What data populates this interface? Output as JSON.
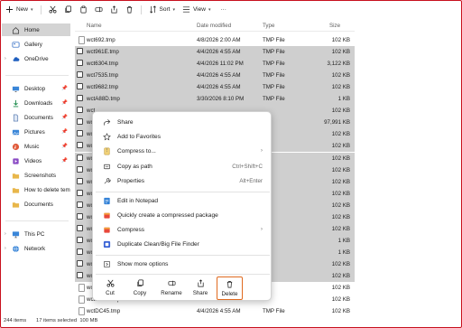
{
  "toolbar": {
    "new_label": "New",
    "sort_label": "Sort",
    "view_label": "View",
    "more_label": "···"
  },
  "sidebar": {
    "items": [
      {
        "label": "Home",
        "icon": "home-icon"
      },
      {
        "label": "Gallery",
        "icon": "gallery-icon"
      },
      {
        "label": "OneDrive",
        "icon": "cloud-icon"
      },
      {
        "label": "Desktop",
        "icon": "desktop-icon"
      },
      {
        "label": "Downloads",
        "icon": "download-icon"
      },
      {
        "label": "Documents",
        "icon": "document-icon"
      },
      {
        "label": "Pictures",
        "icon": "pictures-icon"
      },
      {
        "label": "Music",
        "icon": "music-icon"
      },
      {
        "label": "Videos",
        "icon": "video-icon"
      },
      {
        "label": "Screenshots",
        "icon": "folder-icon"
      },
      {
        "label": "How to delete tem",
        "icon": "folder-icon"
      },
      {
        "label": "Documents",
        "icon": "folder-icon"
      },
      {
        "label": "This PC",
        "icon": "pc-icon"
      },
      {
        "label": "Network",
        "icon": "network-icon"
      }
    ]
  },
  "filelist": {
    "headers": {
      "name": "Name",
      "date": "Date modified",
      "type": "Type",
      "size": "Size"
    },
    "rows": [
      {
        "name": "wct692.tmp",
        "date": "4/8/2026 2:00 AM",
        "type": "TMP File",
        "size": "102 KB",
        "selected": false
      },
      {
        "name": "wct961E.tmp",
        "date": "4/4/2026 4:55 AM",
        "type": "TMP File",
        "size": "102 KB",
        "selected": true
      },
      {
        "name": "wct6304.tmp",
        "date": "4/4/2026 11:02 PM",
        "type": "TMP File",
        "size": "3,122 KB",
        "selected": true
      },
      {
        "name": "wct7535.tmp",
        "date": "4/4/2026 4:55 AM",
        "type": "TMP File",
        "size": "102 KB",
        "selected": true
      },
      {
        "name": "wct9682.tmp",
        "date": "4/4/2026 4:55 AM",
        "type": "TMP File",
        "size": "102 KB",
        "selected": true
      },
      {
        "name": "wctA88D.tmp",
        "date": "3/30/2026 8:10 PM",
        "type": "TMP File",
        "size": "1 KB",
        "selected": true
      },
      {
        "name": "wct",
        "date": "",
        "type": "",
        "size": "102 KB",
        "selected": true
      },
      {
        "name": "wct",
        "date": "",
        "type": "",
        "size": "97,991 KB",
        "selected": true
      },
      {
        "name": "wct",
        "date": "",
        "type": "",
        "size": "102 KB",
        "selected": true
      },
      {
        "name": "wct",
        "date": "",
        "type": "",
        "size": "102 KB",
        "selected": true
      },
      {
        "name": "wct",
        "date": "",
        "type": "",
        "size": "102 KB",
        "selected": true
      },
      {
        "name": "wct",
        "date": "",
        "type": "",
        "size": "102 KB",
        "selected": true
      },
      {
        "name": "wct",
        "date": "",
        "type": "",
        "size": "102 KB",
        "selected": true
      },
      {
        "name": "wct",
        "date": "",
        "type": "",
        "size": "102 KB",
        "selected": true
      },
      {
        "name": "wct",
        "date": "",
        "type": "",
        "size": "102 KB",
        "selected": true
      },
      {
        "name": "wct",
        "date": "",
        "type": "",
        "size": "102 KB",
        "selected": true
      },
      {
        "name": "wct",
        "date": "",
        "type": "",
        "size": "102 KB",
        "selected": true
      },
      {
        "name": "wct",
        "date": "",
        "type": "",
        "size": "1 KB",
        "selected": true
      },
      {
        "name": "wct",
        "date": "",
        "type": "",
        "size": "1 KB",
        "selected": true
      },
      {
        "name": "wct",
        "date": "",
        "type": "",
        "size": "102 KB",
        "selected": true
      },
      {
        "name": "wct",
        "date": "",
        "type": "",
        "size": "102 KB",
        "selected": true
      },
      {
        "name": "wc",
        "date": "",
        "type": "",
        "size": "102 KB",
        "selected": false
      },
      {
        "name": "wctDCaa.tmp",
        "date": "",
        "type": "",
        "size": "102 KB",
        "selected": false
      },
      {
        "name": "wctDC45.tmp",
        "date": "4/4/2026 4:55 AM",
        "type": "TMP File",
        "size": "102 KB",
        "selected": false
      }
    ]
  },
  "context_menu": {
    "items": [
      {
        "label": "Share",
        "icon": "share-icon",
        "shortcut": "",
        "arrow": false
      },
      {
        "label": "Add to Favorites",
        "icon": "star-icon",
        "shortcut": "",
        "arrow": false
      },
      {
        "label": "Compress to...",
        "icon": "zip-icon",
        "shortcut": "",
        "arrow": true
      },
      {
        "label": "Copy as path",
        "icon": "copy-path-icon",
        "shortcut": "Ctrl+Shift+C",
        "arrow": false
      },
      {
        "label": "Properties",
        "icon": "wrench-icon",
        "shortcut": "Alt+Enter",
        "arrow": false
      },
      {
        "label": "Edit in Notepad",
        "icon": "notepad-icon",
        "shortcut": "",
        "arrow": false
      },
      {
        "label": "Quickly create a compressed package",
        "icon": "package-icon",
        "shortcut": "",
        "arrow": false
      },
      {
        "label": "Compress",
        "icon": "compress-icon",
        "shortcut": "",
        "arrow": true
      },
      {
        "label": "Duplicate Clean/Big File Finder",
        "icon": "finder-icon",
        "shortcut": "",
        "arrow": false
      },
      {
        "label": "Show more options",
        "icon": "more-options-icon",
        "shortcut": "",
        "arrow": false
      }
    ],
    "actions": [
      {
        "label": "Cut",
        "icon": "cut-icon"
      },
      {
        "label": "Copy",
        "icon": "copy-icon"
      },
      {
        "label": "Rename",
        "icon": "rename-icon"
      },
      {
        "label": "Share",
        "icon": "share-icon"
      },
      {
        "label": "Delete",
        "icon": "trash-icon"
      }
    ]
  },
  "status": {
    "items_count": "244 items",
    "selection": "17 items selected  100 MB"
  },
  "colors": {
    "selection": "#cfcfcf",
    "highlight_border": "#e06a1f",
    "frame_border": "#c8101e",
    "folder": "#e8b64a",
    "accent": "#1f5fbf"
  }
}
